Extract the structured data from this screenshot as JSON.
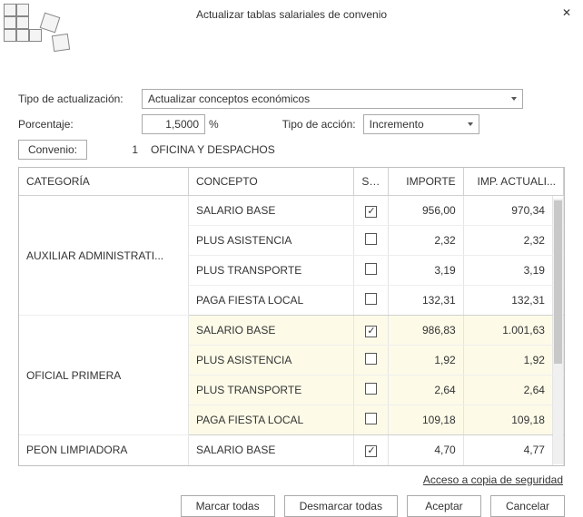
{
  "window": {
    "title": "Actualizar tablas salariales de convenio"
  },
  "form": {
    "tipo_label": "Tipo de actualización:",
    "tipo_value": "Actualizar conceptos económicos",
    "porcentaje_label": "Porcentaje:",
    "porcentaje_value": "1,5000",
    "porcentaje_unit": "%",
    "accion_label": "Tipo de acción:",
    "accion_value": "Incremento",
    "convenio_btn": "Convenio:",
    "convenio_num": "1",
    "convenio_name": "OFICINA Y DESPACHOS"
  },
  "table": {
    "headers": {
      "categoria": "CATEGORÍA",
      "concepto": "CONCEPTO",
      "sel": "SEL",
      "importe": "IMPORTE",
      "imp_act": "IMP. ACTUALI..."
    },
    "groups": [
      {
        "categoria": "AUXILIAR ADMINISTRATI...",
        "rows": [
          {
            "concepto": "SALARIO BASE",
            "sel": true,
            "importe": "956,00",
            "imp_act": "970,34"
          },
          {
            "concepto": "PLUS ASISTENCIA",
            "sel": false,
            "importe": "2,32",
            "imp_act": "2,32"
          },
          {
            "concepto": "PLUS TRANSPORTE",
            "sel": false,
            "importe": "3,19",
            "imp_act": "3,19"
          },
          {
            "concepto": "PAGA FIESTA LOCAL",
            "sel": false,
            "importe": "132,31",
            "imp_act": "132,31"
          }
        ]
      },
      {
        "categoria": "OFICIAL PRIMERA",
        "rows": [
          {
            "concepto": "SALARIO BASE",
            "sel": true,
            "importe": "986,83",
            "imp_act": "1.001,63"
          },
          {
            "concepto": "PLUS ASISTENCIA",
            "sel": false,
            "importe": "1,92",
            "imp_act": "1,92"
          },
          {
            "concepto": "PLUS TRANSPORTE",
            "sel": false,
            "importe": "2,64",
            "imp_act": "2,64"
          },
          {
            "concepto": "PAGA FIESTA LOCAL",
            "sel": false,
            "importe": "109,18",
            "imp_act": "109,18"
          }
        ]
      },
      {
        "categoria": "PEON LIMPIADORA",
        "rows": [
          {
            "concepto": "SALARIO BASE",
            "sel": true,
            "importe": "4,70",
            "imp_act": "4,77"
          }
        ]
      }
    ]
  },
  "footer": {
    "backup_link": "Acceso a copia de seguridad",
    "buttons": {
      "marcar": "Marcar todas",
      "desmarcar": "Desmarcar todas",
      "aceptar": "Aceptar",
      "cancelar": "Cancelar"
    }
  },
  "check_mark": "✓"
}
